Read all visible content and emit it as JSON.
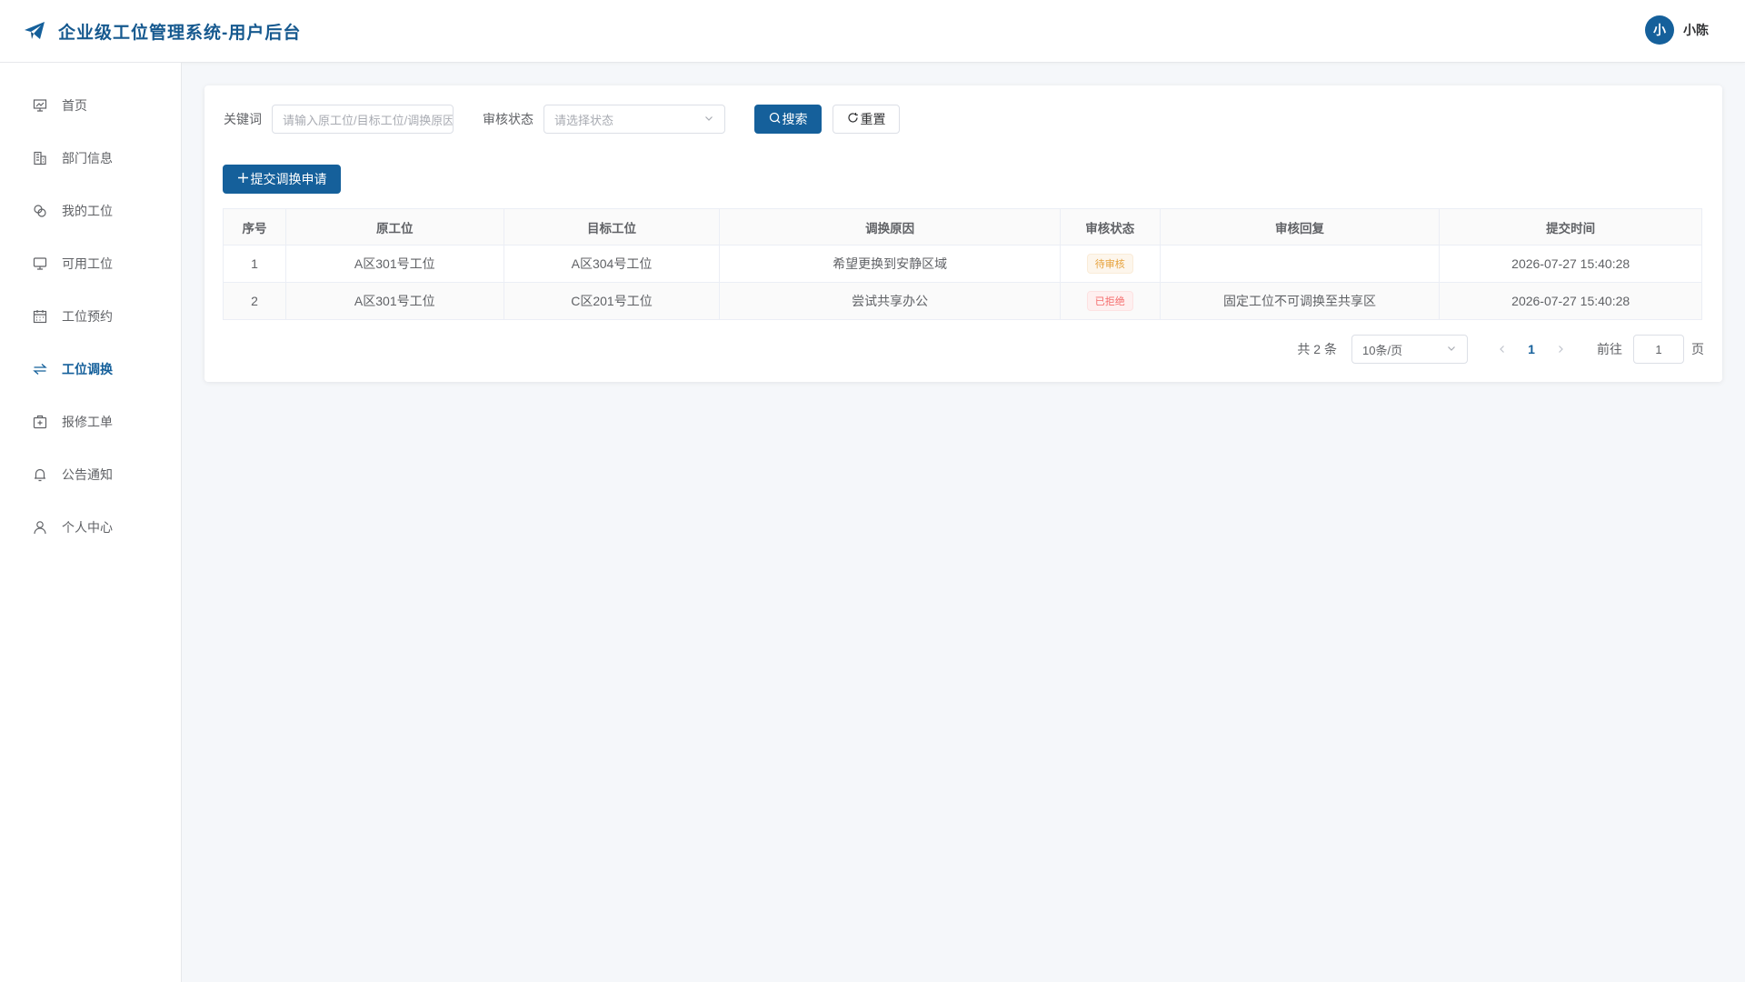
{
  "header": {
    "title": "企业级工位管理系统-用户后台",
    "user_initial": "小",
    "user_name": "小陈"
  },
  "sidebar": {
    "items": [
      {
        "label": "首页",
        "icon": "dashboard-icon",
        "active": false
      },
      {
        "label": "部门信息",
        "icon": "building-icon",
        "active": false
      },
      {
        "label": "我的工位",
        "icon": "seat-icon",
        "active": false
      },
      {
        "label": "可用工位",
        "icon": "monitor-icon",
        "active": false
      },
      {
        "label": "工位预约",
        "icon": "calendar-icon",
        "active": false
      },
      {
        "label": "工位调换",
        "icon": "swap-icon",
        "active": true
      },
      {
        "label": "报修工单",
        "icon": "repair-kit-icon",
        "active": false
      },
      {
        "label": "公告通知",
        "icon": "bell-icon",
        "active": false
      },
      {
        "label": "个人中心",
        "icon": "user-icon",
        "active": false
      }
    ]
  },
  "filters": {
    "keyword_label": "关键词",
    "keyword_placeholder": "请输入原工位/目标工位/调换原因",
    "status_label": "审核状态",
    "status_placeholder": "请选择状态",
    "search_label": "搜索",
    "reset_label": "重置"
  },
  "actions": {
    "add_label": "提交调换申请"
  },
  "table": {
    "columns": [
      "序号",
      "原工位",
      "目标工位",
      "调换原因",
      "审核状态",
      "审核回复",
      "提交时间"
    ],
    "rows": [
      {
        "index": "1",
        "from": "A区301号工位",
        "to": "A区304号工位",
        "reason": "希望更换到安静区域",
        "status": "待审核",
        "reply": "",
        "time": "2026-07-27 15:40:28"
      },
      {
        "index": "2",
        "from": "A区301号工位",
        "to": "C区201号工位",
        "reason": "尝试共享办公",
        "status": "已拒绝",
        "reply": "固定工位不可调换至共享区",
        "time": "2026-07-27 15:40:28"
      }
    ]
  },
  "pagination": {
    "total": "共 2 条",
    "page_size": "10条/页",
    "current_page": "1",
    "goto_label": "前往",
    "goto_value": "1",
    "page_unit": "页"
  },
  "colors": {
    "primary": "#15609b",
    "warning": "#e6a23c",
    "danger": "#f56c6c"
  }
}
